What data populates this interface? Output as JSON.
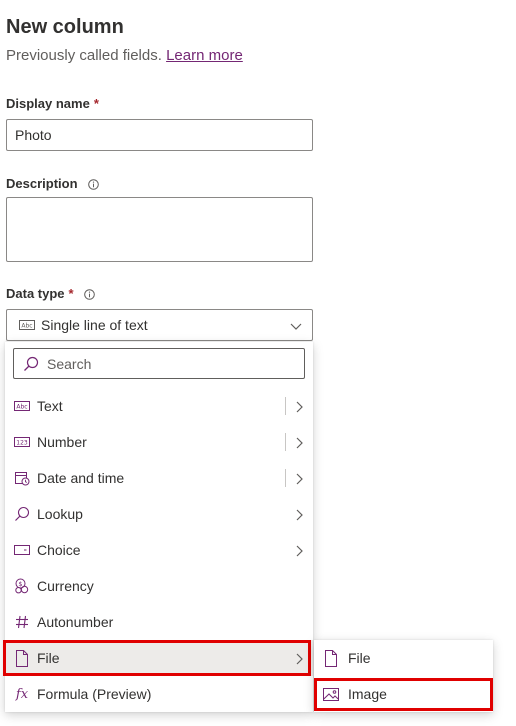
{
  "panel": {
    "title": "New column",
    "subtitle": "Previously called fields.",
    "learn_more": "Learn more"
  },
  "display_name": {
    "label": "Display name",
    "required": "*",
    "value": "Photo"
  },
  "description": {
    "label": "Description",
    "value": ""
  },
  "data_type": {
    "label": "Data type",
    "required": "*",
    "selected": "Single line of text",
    "selected_icon": "abc-text-icon"
  },
  "menu": {
    "search_placeholder": "Search",
    "items": [
      {
        "label": "Text",
        "icon": "abc-text-icon",
        "has_submenu": true
      },
      {
        "label": "Number",
        "icon": "number-123-icon",
        "has_submenu": true
      },
      {
        "label": "Date and time",
        "icon": "calendar-clock-icon",
        "has_submenu": true
      },
      {
        "label": "Lookup",
        "icon": "search-icon",
        "has_submenu": true
      },
      {
        "label": "Choice",
        "icon": "choice-icon",
        "has_submenu": true
      },
      {
        "label": "Currency",
        "icon": "currency-icon",
        "has_submenu": false
      },
      {
        "label": "Autonumber",
        "icon": "hash-icon",
        "has_submenu": false
      },
      {
        "label": "File",
        "icon": "file-icon",
        "has_submenu": true,
        "active": true
      },
      {
        "label": "Formula (Preview)",
        "icon": "fx-icon",
        "has_submenu": false
      }
    ]
  },
  "submenu": {
    "items": [
      {
        "label": "File",
        "icon": "file-icon"
      },
      {
        "label": "Image",
        "icon": "image-icon"
      }
    ]
  },
  "colors": {
    "accent": "#742774",
    "highlight": "#e00000",
    "required": "#a4262c"
  }
}
